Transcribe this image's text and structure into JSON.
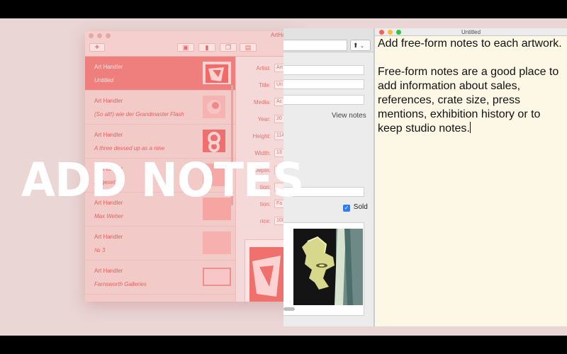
{
  "overlay": {
    "title": "ADD NOTES"
  },
  "app_window": {
    "title": "ArtHa",
    "artworks": [
      {
        "artist": "Art Handler",
        "title": "Untitled",
        "selected": true
      },
      {
        "artist": "Art Handler",
        "title": "(So alt!) wie der Grandmaster Flash"
      },
      {
        "artist": "Art Handler",
        "title": "A three dessed up as a nine"
      },
      {
        "artist": "Art Handler",
        "title": "Abgesetzt a"
      },
      {
        "artist": "Art Handler",
        "title": "Max Weber"
      },
      {
        "artist": "Art Handler",
        "title": "№ 3"
      },
      {
        "artist": "Art Handler",
        "title": "Farnsworth Galleries"
      }
    ],
    "form": {
      "artist_label": "Artist:",
      "artist_value": "Art",
      "title_label": "Title:",
      "title_value": "Un",
      "media_label": "Media:",
      "media_value": "Ac",
      "year_label": "Year:",
      "year_value": "20",
      "height_label": "Height:",
      "height_value": "114",
      "width_label": "Width:",
      "width_value": "13",
      "depth_label": "Depth:",
      "depth_value": "",
      "edition_label": "tion:",
      "edition_value": "",
      "location_label": "tion:",
      "location_value": "Fa",
      "price_label": "rice:",
      "price_value": "100"
    }
  },
  "mid_window": {
    "view_notes": "View notes",
    "sold_label": "Sold",
    "sold_checked": true
  },
  "notes_window": {
    "title": "Untitled",
    "paragraphs": [
      "Add free-form notes to each artwork.",
      "Free-form notes are a good place to add information about sales, references, crate size, press mentions, exhibition history or to keep studio notes."
    ]
  },
  "colors": {
    "stage_bg": "#ead6d5",
    "accent_red": "#ef7f7d",
    "notes_bg": "#fdf8e6",
    "checkbox_blue": "#2f7cf6"
  },
  "icons": [
    "plus-icon",
    "export-icon",
    "delete-icon",
    "duplicate-icon",
    "print-icon",
    "share-icon",
    "chevron-down-icon",
    "checkmark-icon"
  ]
}
